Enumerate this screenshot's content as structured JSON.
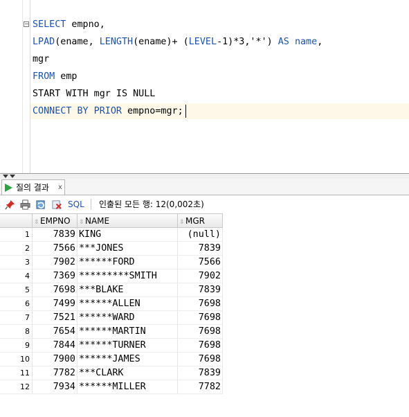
{
  "editor": {
    "lines": [
      [
        {
          "t": "SELECT",
          "k": "kw"
        },
        {
          "t": " empno,",
          "k": ""
        }
      ],
      [
        {
          "t": "LPAD",
          "k": "kw"
        },
        {
          "t": "(ename, ",
          "k": ""
        },
        {
          "t": "LENGTH",
          "k": "kw"
        },
        {
          "t": "(ename)+ (",
          "k": ""
        },
        {
          "t": "LEVEL",
          "k": "kw"
        },
        {
          "t": "-1)*3,'*') ",
          "k": ""
        },
        {
          "t": "AS",
          "k": "kw"
        },
        {
          "t": " ",
          "k": ""
        },
        {
          "t": "name",
          "k": "kw"
        },
        {
          "t": ",",
          "k": ""
        }
      ],
      [
        {
          "t": "mgr",
          "k": ""
        }
      ],
      [
        {
          "t": "FROM",
          "k": "kw"
        },
        {
          "t": " emp",
          "k": ""
        }
      ],
      [
        {
          "t": "START WITH mgr IS NULL",
          "k": ""
        }
      ],
      [
        {
          "t": "CONNECT BY PRIOR",
          "k": "kw"
        },
        {
          "t": " empno=mgr;",
          "k": ""
        }
      ]
    ]
  },
  "results_tab": {
    "label": "질의 결과",
    "close": "x"
  },
  "toolbar": {
    "sql_label": "SQL",
    "status": "인출된 모든 행: 12(0,002초)"
  },
  "grid": {
    "columns": [
      "EMPNO",
      "NAME",
      "MGR"
    ],
    "rows": [
      [
        "1",
        "7839",
        "KING",
        "(null)"
      ],
      [
        "2",
        "7566",
        "***JONES",
        "7839"
      ],
      [
        "3",
        "7902",
        "******FORD",
        "7566"
      ],
      [
        "4",
        "7369",
        "*********SMITH",
        "7902"
      ],
      [
        "5",
        "7698",
        "***BLAKE",
        "7839"
      ],
      [
        "6",
        "7499",
        "******ALLEN",
        "7698"
      ],
      [
        "7",
        "7521",
        "******WARD",
        "7698"
      ],
      [
        "8",
        "7654",
        "******MARTIN",
        "7698"
      ],
      [
        "9",
        "7844",
        "******TURNER",
        "7698"
      ],
      [
        "10",
        "7900",
        "******JAMES",
        "7698"
      ],
      [
        "11",
        "7782",
        "***CLARK",
        "7839"
      ],
      [
        "12",
        "7934",
        "******MILLER",
        "7782"
      ]
    ]
  },
  "colors": {
    "keyword": "#1a51b8",
    "current_line": "#fdf8e7",
    "run_green": "#2aa43b"
  }
}
